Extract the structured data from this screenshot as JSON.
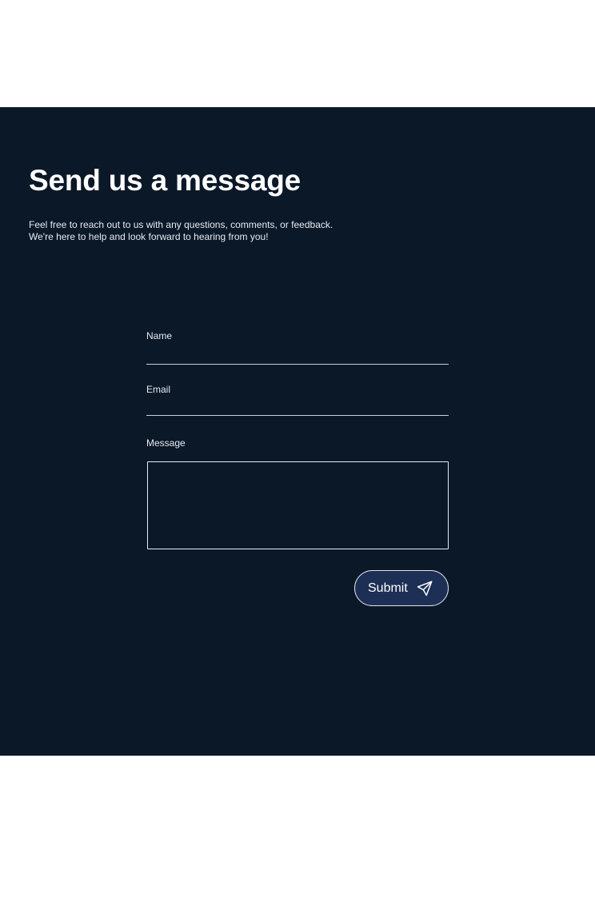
{
  "contact": {
    "heading": "Send us a message",
    "intro_line1": "Feel free to reach out to us with any questions, comments, or feedback.",
    "intro_line2": "We're here to help and look forward to hearing from you!",
    "form": {
      "name_label": "Name",
      "name_value": "",
      "email_label": "Email",
      "email_value": "",
      "message_label": "Message",
      "message_value": "",
      "submit_label": "Submit",
      "submit_icon": "send-icon"
    }
  },
  "colors": {
    "section_background": "#0b1828",
    "button_background": "#1d2f54",
    "text": "#ffffff"
  }
}
